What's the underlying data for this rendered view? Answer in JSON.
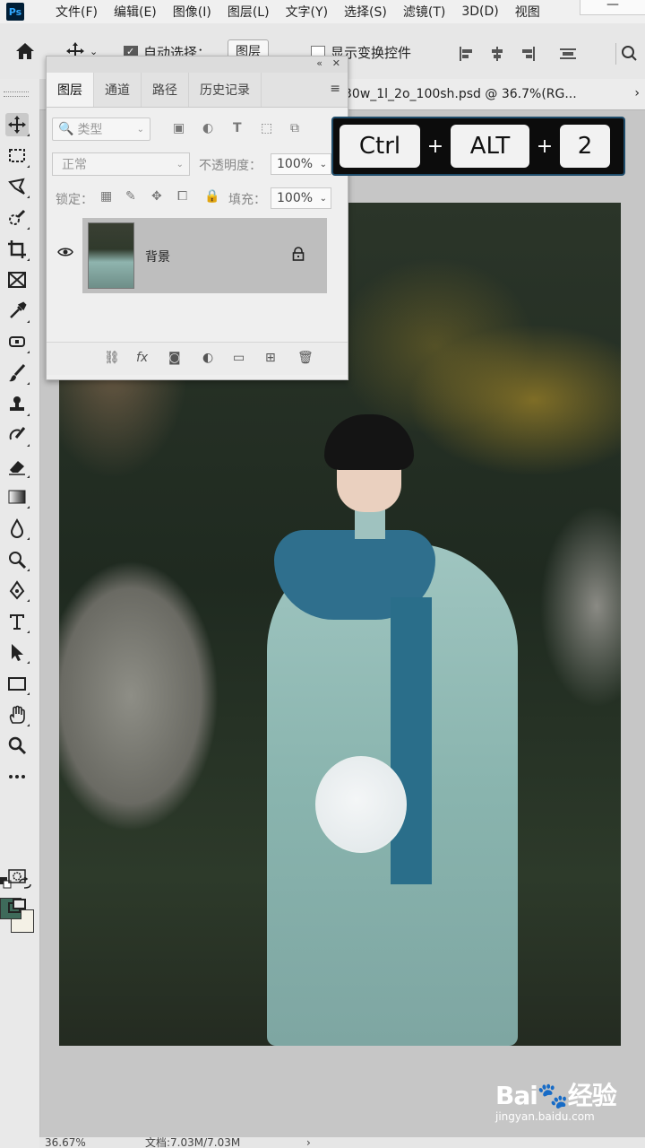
{
  "app": {
    "logo_text": "Ps"
  },
  "menubar": {
    "items": [
      "文件(F)",
      "编辑(E)",
      "图像(I)",
      "图层(L)",
      "文字(Y)",
      "选择(S)",
      "滤镜(T)",
      "3D(D)",
      "视图"
    ],
    "window_control": "—"
  },
  "options": {
    "auto_select_label": "自动选择：",
    "auto_select_checked": true,
    "auto_select_target": "图层",
    "show_transform_label": "显示变换控件",
    "show_transform_checked": false
  },
  "tabs": {
    "document_title": "30w_1l_2o_100sh.psd @ 36.7%(RG...",
    "more_arrow": "›"
  },
  "layers_panel": {
    "tabs": [
      "图层",
      "通道",
      "路径",
      "历史记录"
    ],
    "filter_placeholder": "类型",
    "blend_mode": "正常",
    "opacity_label": "不透明度：",
    "opacity_value": "100%",
    "lock_label": "锁定：",
    "fill_label": "填充：",
    "fill_value": "100%",
    "layers": [
      {
        "name": "背景",
        "visible": true,
        "locked": true
      }
    ],
    "footer_icons": [
      "link-layers-icon",
      "fx-icon",
      "add-mask-icon",
      "adjustment-layer-icon",
      "new-group-icon",
      "new-layer-icon",
      "delete-layer-icon"
    ]
  },
  "shortcut_overlay": {
    "keys": [
      "Ctrl",
      "ALT",
      "2"
    ],
    "separator": "+"
  },
  "statusbar": {
    "zoom": "36.67%",
    "doc_info": "文档:7.03M/7.03M"
  },
  "watermark": {
    "logo": "Bai🐾经验",
    "url": "jingyan.baidu.com"
  },
  "colors": {
    "foreground": "#3e6a5a",
    "background": "#f4f1e6",
    "overlay_border": "#1f4c6a"
  }
}
